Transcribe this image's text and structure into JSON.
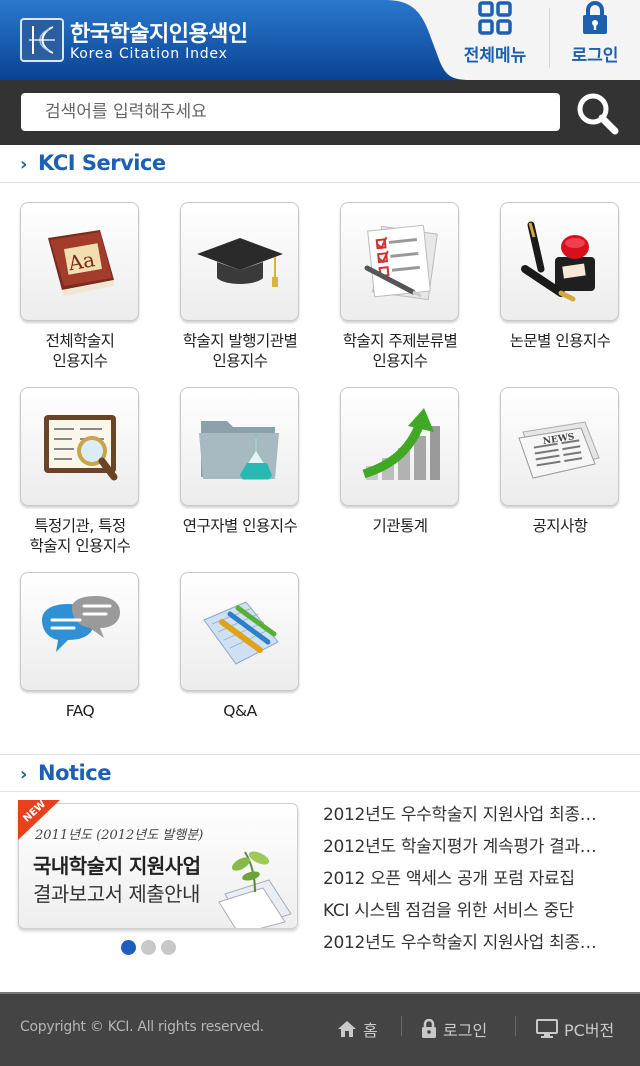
{
  "header": {
    "brand_title": "한국학술지인용색인",
    "brand_subtitle": "Korea Citation Index",
    "menu_label": "전체메뉴",
    "login_label": "로그인"
  },
  "search": {
    "placeholder": "검색어를 입력해주세요"
  },
  "service": {
    "section_title": "KCI Service",
    "items": [
      {
        "line1": "전체학술지",
        "line2": "인용지수",
        "icon": "dictionary-book-icon"
      },
      {
        "line1": "학술지 발행기관별",
        "line2": "인용지수",
        "icon": "graduation-cap-icon"
      },
      {
        "line1": "학술지 주제분류별",
        "line2": "인용지수",
        "icon": "checklist-pen-icon"
      },
      {
        "line1": "논문별 인용지수",
        "line2": "",
        "icon": "fountain-pen-ink-icon"
      },
      {
        "line1": "특정기관, 특정",
        "line2": "학술지 인용지수",
        "icon": "magnifier-chalkboard-icon"
      },
      {
        "line1": "연구자별 인용지수",
        "line2": "",
        "icon": "folder-flask-icon"
      },
      {
        "line1": "기관통계",
        "line2": "",
        "icon": "bar-chart-arrow-icon"
      },
      {
        "line1": "공지사항",
        "line2": "",
        "icon": "newspaper-icon"
      },
      {
        "line1": "FAQ",
        "line2": "",
        "icon": "speech-bubbles-icon"
      },
      {
        "line1": "Q&A",
        "line2": "",
        "icon": "notepad-pencils-icon"
      }
    ]
  },
  "notice": {
    "section_title": "Notice",
    "banner": {
      "badge": "NEW",
      "line1": "2011년도 (2012년도 발행분)",
      "line2": "국내학술지 지원사업",
      "line3": "결과보고서 제출안내"
    },
    "items": [
      "2012년도 우수학술지 지원사업 최종…",
      "2012년도 학술지평가 계속평가 결과…",
      "2012 오픈 액세스 공개 포럼 자료집",
      "KCI 시스템 점검을 위한 서비스 중단",
      "2012년도 우수학술지 지원사업 최종…"
    ]
  },
  "footer": {
    "copyright": "Copyright © KCI. All rights reserved.",
    "home_label": "홈",
    "login_label": "로그인",
    "pc_label": "PC버전"
  },
  "colors": {
    "brand_blue": "#1d5fb0",
    "header_gradient_dark": "#0d4a9e",
    "search_bar": "#333333",
    "footer": "#444444",
    "dot_active": "#1f5ec1"
  }
}
